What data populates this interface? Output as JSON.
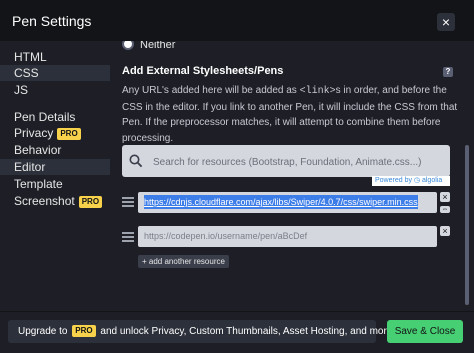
{
  "header": {
    "title": "Pen Settings",
    "close_label": "×"
  },
  "sidebar": {
    "items": [
      {
        "label": "HTML"
      },
      {
        "label": "CSS"
      },
      {
        "label": "JS"
      },
      {
        "label": "Pen Details"
      },
      {
        "label": "Privacy",
        "badge": "PRO"
      },
      {
        "label": "Behavior"
      },
      {
        "label": "Editor"
      },
      {
        "label": "Template"
      },
      {
        "label": "Screenshot",
        "badge": "PRO"
      }
    ]
  },
  "main": {
    "radio_label": "Neither",
    "section_title": "Add External Stylesheets/Pens",
    "help_label": "?",
    "desc_before": "Any URL's added here will be added as ",
    "desc_code": "<link>",
    "desc_after": "s in order, and before the CSS in the editor. If you link to another Pen, it will include the CSS from that Pen. If the preprocessor matches, it will attempt to combine them before processing.",
    "search": {
      "placeholder": "Search for resources (Bootstrap, Foundation, Animate.css...)",
      "value": ""
    },
    "powered_by": "Powered by",
    "algolia": "algolia",
    "resources": [
      {
        "value": "https://cdnjs.cloudflare.com/ajax/libs/Swiper/4.0.7/css/swiper.min.css",
        "placeholder": ""
      },
      {
        "value": "",
        "placeholder": "https://codepen.io/username/pen/aBcDef"
      }
    ],
    "remove_label": "×",
    "toggle_label": "⇔",
    "add_label": "+ add another resource"
  },
  "footer": {
    "upgrade_prefix": "Upgrade to",
    "upgrade_badge": "PRO",
    "upgrade_suffix": "and unlock Privacy, Custom Thumbnails, Asset Hosting, and more.",
    "save_label": "Save & Close"
  },
  "colors": {
    "accent": "#47cf73",
    "pro": "#f7d24a",
    "header_bg": "#131417",
    "modal_bg": "#1e1f26"
  }
}
